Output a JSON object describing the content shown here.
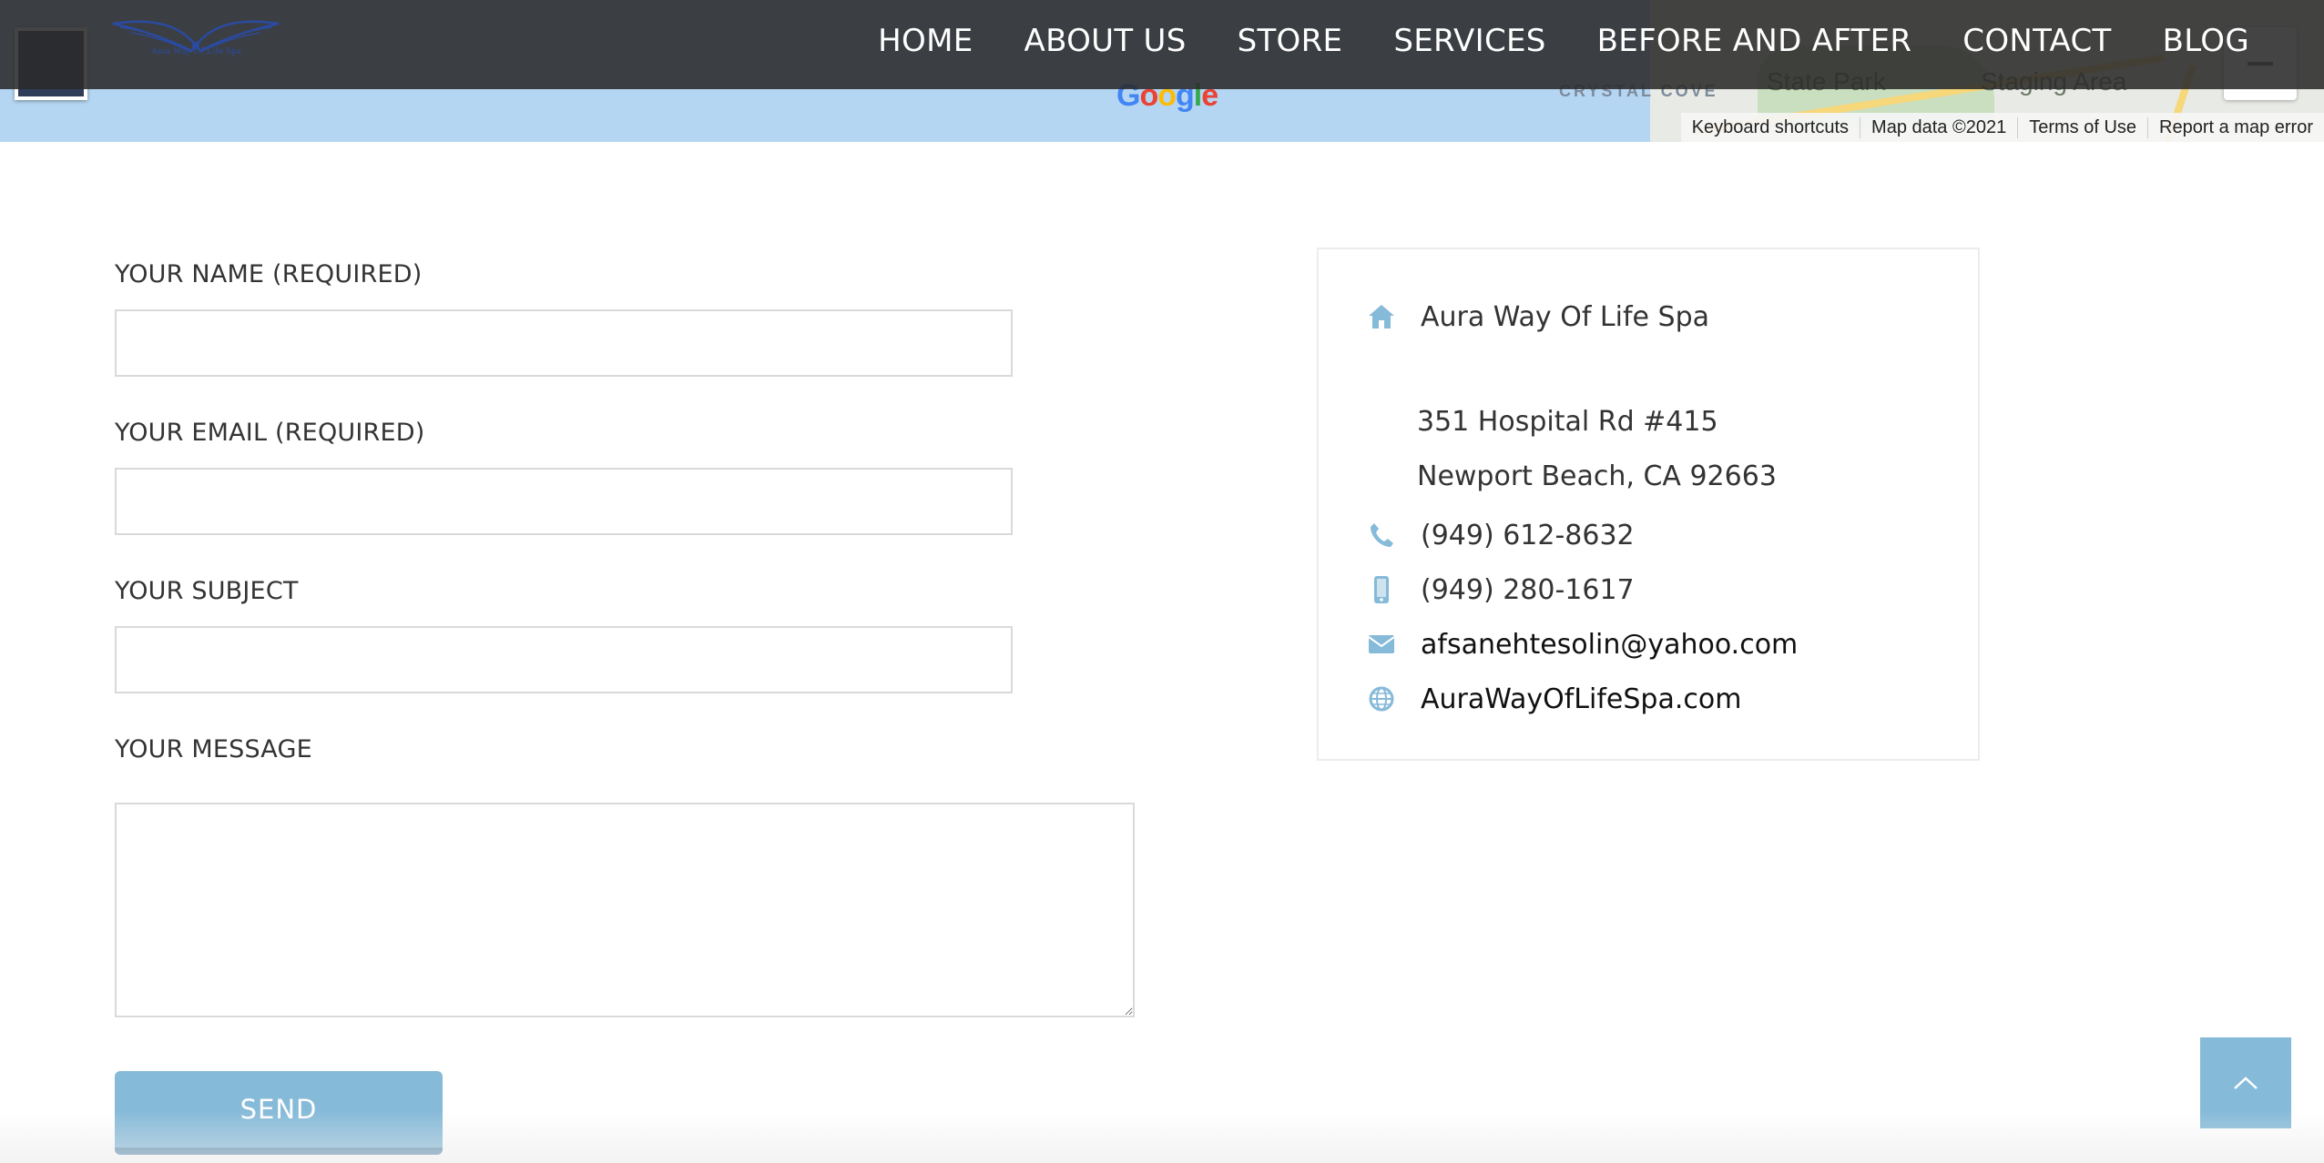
{
  "map": {
    "labels": {
      "coast": "CRYSTAL COVE",
      "park": "State Park",
      "staging": "Staging Area"
    },
    "google_logo": [
      "G",
      "o",
      "o",
      "g",
      "l",
      "e"
    ],
    "footer": {
      "shortcuts": "Keyboard shortcuts",
      "map_data": "Map data ©2021",
      "terms": "Terms of Use",
      "report": "Report a map error"
    }
  },
  "header": {
    "logo_text": "Aura Way Of Life Spa",
    "nav": [
      {
        "label": "HOME"
      },
      {
        "label": "ABOUT US"
      },
      {
        "label": "STORE"
      },
      {
        "label": "SERVICES"
      },
      {
        "label": "BEFORE AND AFTER"
      },
      {
        "label": "CONTACT"
      },
      {
        "label": "BLOG"
      }
    ]
  },
  "form": {
    "name_label": "YOUR NAME (REQUIRED)",
    "name_value": "",
    "email_label": "YOUR EMAIL (REQUIRED)",
    "email_value": "",
    "subject_label": "YOUR SUBJECT",
    "subject_value": "",
    "message_label": "YOUR MESSAGE",
    "message_value": "",
    "send_label": "SEND"
  },
  "contact": {
    "business_name": "Aura Way Of Life Spa",
    "address_line1": "351 Hospital Rd #415",
    "address_line2": "Newport Beach, CA 92663",
    "phone": "(949) 612-8632",
    "mobile": "(949) 280-1617",
    "email": "afsanehtesolin@yahoo.com",
    "website": "AuraWayOfLifeSpa.com",
    "icon_color": "#86bad9",
    "icons": {
      "home": "home-icon",
      "phone": "phone-icon",
      "mobile": "mobile-phone-icon",
      "email": "envelope-icon",
      "web": "globe-icon"
    }
  },
  "colors": {
    "accent": "#86bad9",
    "header_bg": "#2a2a2a",
    "map_water": "#b5d6f2"
  }
}
